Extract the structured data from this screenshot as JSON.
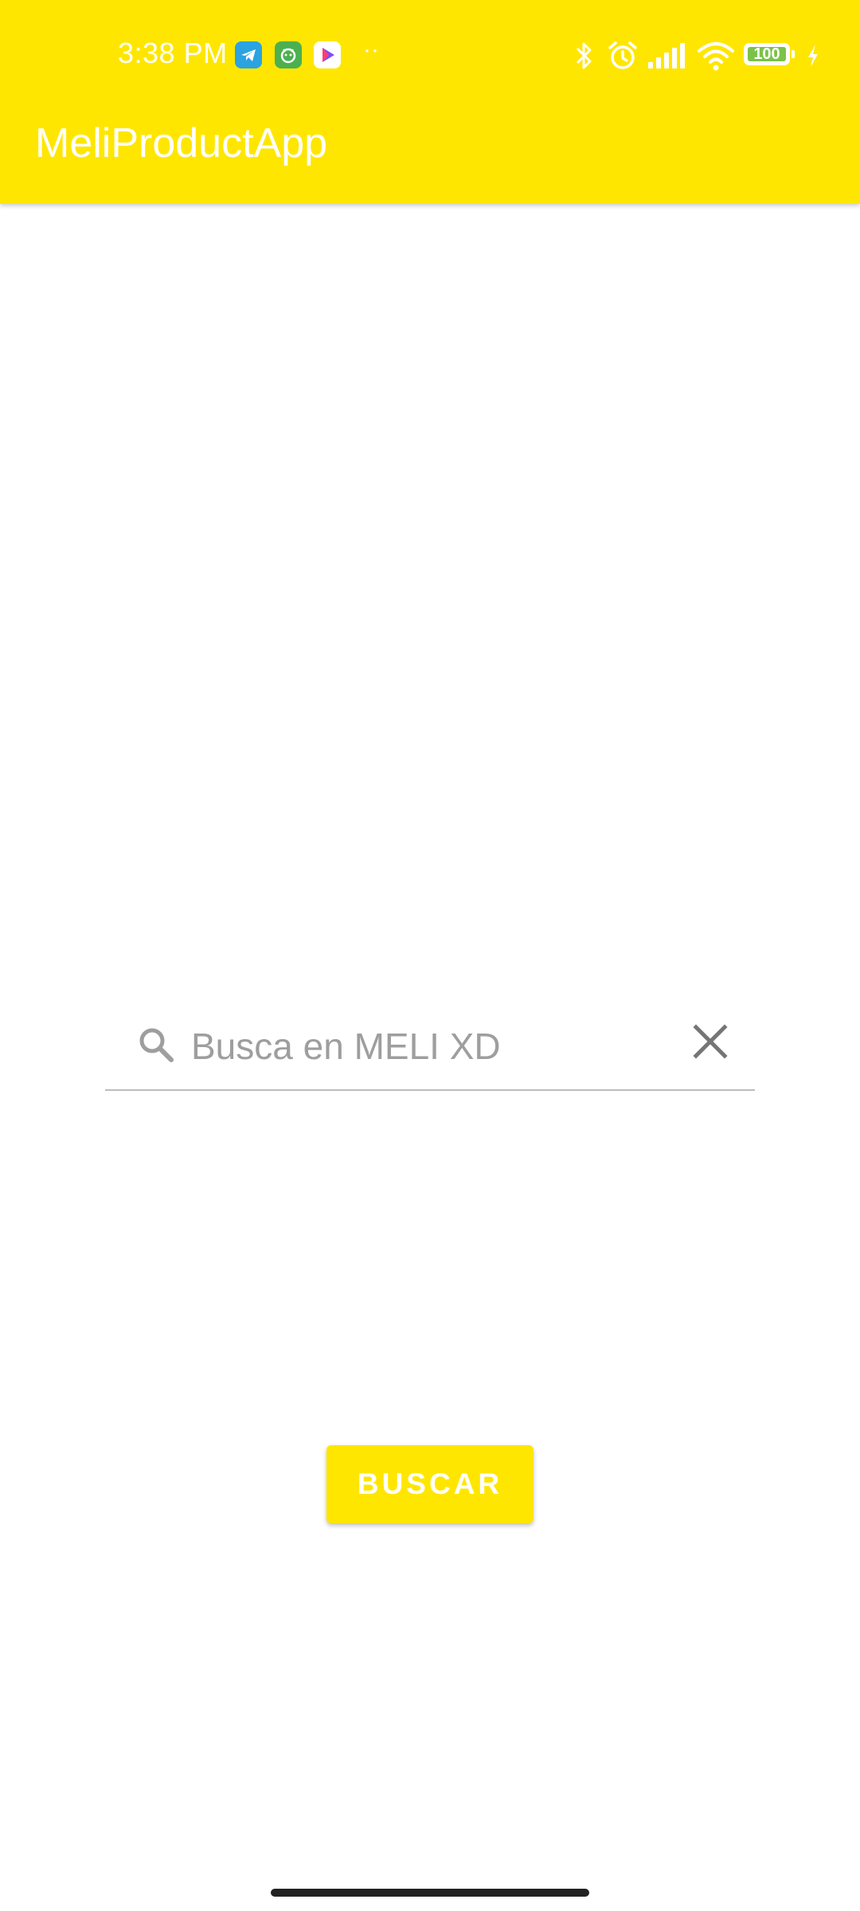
{
  "status_bar": {
    "time": "3:38 PM",
    "overflow_dots": "··",
    "battery_level": "100",
    "notification_icons": [
      "telegram-icon",
      "green-app-icon",
      "play-store-icon"
    ],
    "system_icons": [
      "bluetooth-icon",
      "alarm-icon",
      "signal-icon",
      "wifi-icon",
      "battery-icon",
      "charging-icon"
    ]
  },
  "app_bar": {
    "title": "MeliProductApp"
  },
  "search": {
    "placeholder": "Busca en MELI XD",
    "value": "",
    "leading_icon": "search-icon",
    "trailing_icon": "close-icon"
  },
  "actions": {
    "search_button_label": "BUSCAR"
  },
  "colors": {
    "brand_yellow": "#FFE600",
    "on_brand": "#FFFFFF",
    "underline": "#BDBDBD",
    "placeholder": "#9E9E9E",
    "icon_gray": "#757575",
    "background": "#FFFFFF"
  }
}
